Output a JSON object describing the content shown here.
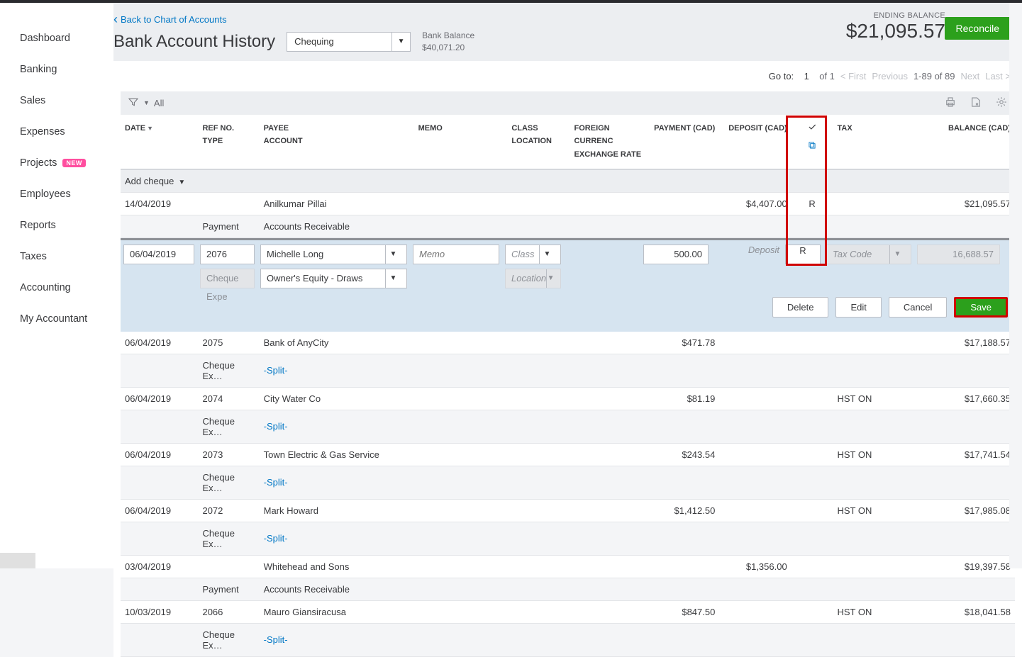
{
  "sidebar": {
    "items": [
      {
        "label": "Dashboard"
      },
      {
        "label": "Banking"
      },
      {
        "label": "Sales"
      },
      {
        "label": "Expenses"
      },
      {
        "label": "Projects",
        "badge": "NEW"
      },
      {
        "label": "Employees"
      },
      {
        "label": "Reports"
      },
      {
        "label": "Taxes"
      },
      {
        "label": "Accounting"
      },
      {
        "label": "My Accountant"
      }
    ]
  },
  "header": {
    "back_label": "Back to Chart of Accounts",
    "title": "Bank Account History",
    "account_selected": "Chequing",
    "bank_balance_label": "Bank Balance",
    "bank_balance_value": "$40,071.20",
    "ending_balance_label": "ENDING BALANCE",
    "ending_balance_value": "$21,095.57",
    "reconcile_label": "Reconcile"
  },
  "pager": {
    "goto_label": "Go to:",
    "page": "1",
    "of_label": "of 1",
    "first": "< First",
    "previous": "Previous",
    "range": "1-89 of 89",
    "next": "Next",
    "last": "Last >"
  },
  "filter": {
    "label": "All"
  },
  "columns": {
    "date": "DATE",
    "ref": "REF NO.",
    "type": "TYPE",
    "payee": "PAYEE",
    "account": "ACCOUNT",
    "memo": "MEMO",
    "class": "CLASS",
    "location": "LOCATION",
    "foreign": "FOREIGN CURRENC",
    "exchange": "EXCHANGE RATE",
    "payment": "PAYMENT (CAD)",
    "deposit": "DEPOSIT (CAD)",
    "tax": "TAX",
    "balance": "BALANCE (CAD)"
  },
  "add_row_label": "Add cheque",
  "rows": [
    {
      "date": "14/04/2019",
      "ref": "",
      "payee": "Anilkumar Pillai",
      "payment": "",
      "deposit": "$4,407.00",
      "rec": "R",
      "tax": "",
      "balance": "$21,095.57",
      "type": "Payment",
      "account": "Accounts Receivable"
    }
  ],
  "edit": {
    "date": "06/04/2019",
    "ref": "2076",
    "payee": "Michelle Long",
    "memo_placeholder": "Memo",
    "class_placeholder": "Class",
    "payment": "500.00",
    "deposit_placeholder": "Deposit",
    "rec": "R",
    "tax_placeholder": "Tax Code",
    "balance": "16,688.57",
    "type": "Cheque Expe",
    "account": "Owner's Equity - Draws",
    "location_placeholder": "Location",
    "buttons": {
      "delete": "Delete",
      "edit": "Edit",
      "cancel": "Cancel",
      "save": "Save"
    }
  },
  "rows2": [
    {
      "date": "06/04/2019",
      "ref": "2075",
      "payee": "Bank of AnyCity",
      "payment": "$471.78",
      "deposit": "",
      "rec": "",
      "tax": "",
      "balance": "$17,188.57",
      "type": "Cheque Ex…",
      "account": "-Split-",
      "split": true
    },
    {
      "date": "06/04/2019",
      "ref": "2074",
      "payee": "City Water Co",
      "payment": "$81.19",
      "deposit": "",
      "rec": "",
      "tax": "HST ON",
      "balance": "$17,660.35",
      "type": "Cheque Ex…",
      "account": "-Split-",
      "split": true
    },
    {
      "date": "06/04/2019",
      "ref": "2073",
      "payee": "Town Electric & Gas Service",
      "payment": "$243.54",
      "deposit": "",
      "rec": "",
      "tax": "HST ON",
      "balance": "$17,741.54",
      "type": "Cheque Ex…",
      "account": "-Split-",
      "split": true
    },
    {
      "date": "06/04/2019",
      "ref": "2072",
      "payee": "Mark Howard",
      "payment": "$1,412.50",
      "deposit": "",
      "rec": "",
      "tax": "HST ON",
      "balance": "$17,985.08",
      "type": "Cheque Ex…",
      "account": "-Split-",
      "split": true
    },
    {
      "date": "03/04/2019",
      "ref": "",
      "payee": "Whitehead and Sons",
      "payment": "",
      "deposit": "$1,356.00",
      "rec": "",
      "tax": "",
      "balance": "$19,397.58",
      "type": "Payment",
      "account": "Accounts Receivable",
      "split": false
    },
    {
      "date": "10/03/2019",
      "ref": "2066",
      "payee": "Mauro Giansiracusa",
      "payment": "$847.50",
      "deposit": "",
      "rec": "",
      "tax": "HST ON",
      "balance": "$18,041.58",
      "type": "Cheque Ex…",
      "account": "-Split-",
      "split": true
    }
  ]
}
